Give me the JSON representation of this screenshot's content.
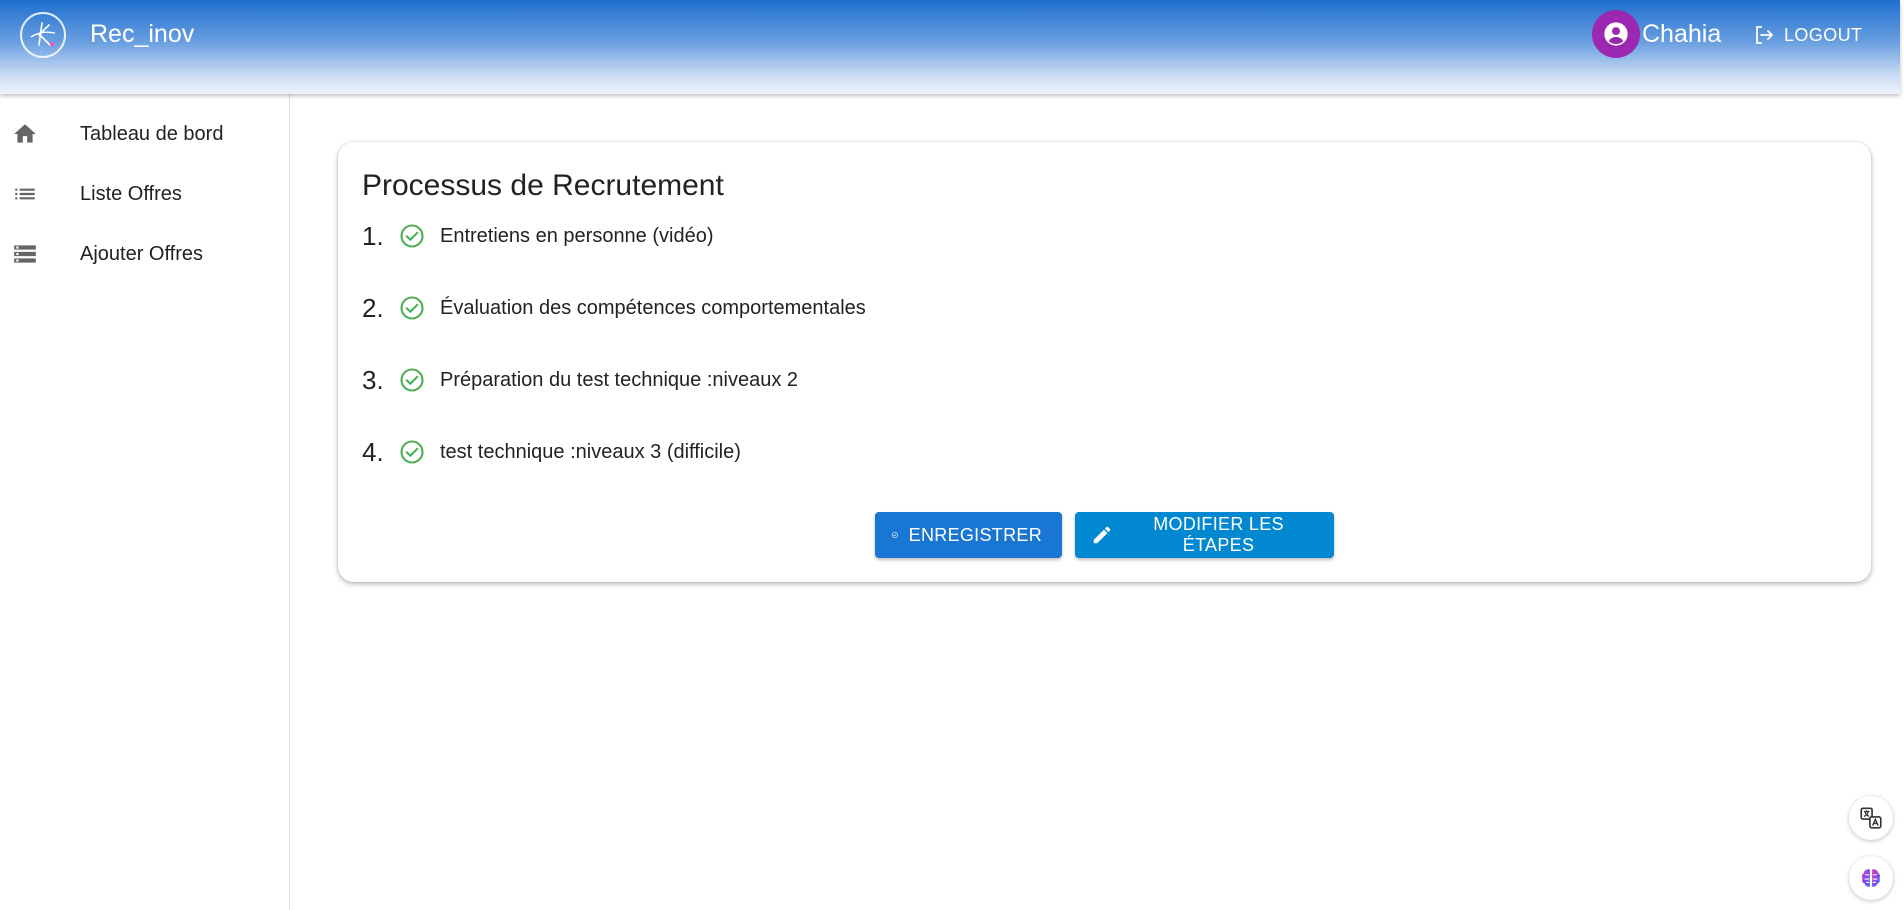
{
  "header": {
    "brand": "Rec_inov",
    "user_name": "Chahia",
    "logout_label": "LOGOUT",
    "background_color": "#1e6fcf"
  },
  "sidebar": {
    "items": [
      {
        "label": "Tableau de bord",
        "icon": "home-icon"
      },
      {
        "label": "Liste Offres",
        "icon": "list-icon"
      },
      {
        "label": "Ajouter Offres",
        "icon": "storage-icon"
      }
    ]
  },
  "main": {
    "title": "Processus de Recrutement",
    "steps": [
      {
        "number": "1.",
        "text": "Entretiens en personne (vidéo)"
      },
      {
        "number": "2.",
        "text": "Évaluation des compétences comportementales"
      },
      {
        "number": "3.",
        "text": "Préparation du test technique :niveaux 2"
      },
      {
        "number": "4.",
        "text": "test technique :niveaux 3 (difficile)"
      }
    ],
    "save_label": "ENREGISTRER",
    "edit_label": "MODIFIER LES ÉTAPES"
  },
  "colors": {
    "check_green": "#4caf50",
    "save_button": "#1976d2",
    "edit_button": "#0288d1",
    "avatar": "#9c27b0"
  },
  "floating": {
    "translate_icon": "translate-icon",
    "brain_icon": "brain-icon"
  }
}
